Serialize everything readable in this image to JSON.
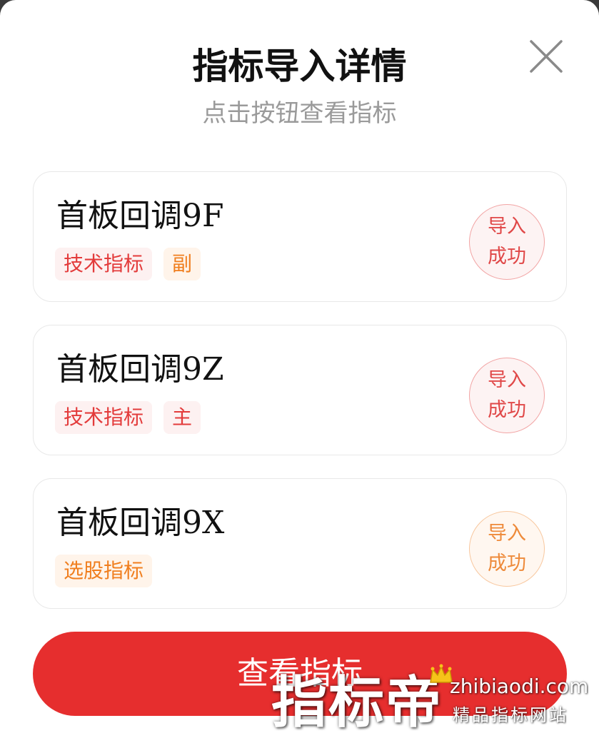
{
  "modal": {
    "title": "指标导入详情",
    "subtitle": "点击按钮查看指标",
    "close_icon": "close-icon"
  },
  "indicators": [
    {
      "name": "首板回调9F",
      "tags": [
        {
          "label": "技术指标",
          "color": "#e33b3b"
        },
        {
          "label": "副",
          "color": "#f07e1e"
        }
      ],
      "status_line1": "导入",
      "status_line2": "成功",
      "status_color": "#e04848"
    },
    {
      "name": "首板回调9Z",
      "tags": [
        {
          "label": "技术指标",
          "color": "#e33b3b"
        },
        {
          "label": "主",
          "color": "#e33b3b"
        }
      ],
      "status_line1": "导入",
      "status_line2": "成功",
      "status_color": "#e04848"
    },
    {
      "name": "首板回调9X",
      "tags": [
        {
          "label": "选股指标",
          "color": "#f07e1e"
        }
      ],
      "status_line1": "导入",
      "status_line2": "成功",
      "status_color": "#ee8a3a"
    }
  ],
  "action": {
    "view_label": "查看指标",
    "color": "#e62e2e"
  },
  "watermark": {
    "brand": "指标帝",
    "url": "zhibiaodi.com",
    "slogan": "精品指标网站",
    "icon": "crown-icon"
  }
}
